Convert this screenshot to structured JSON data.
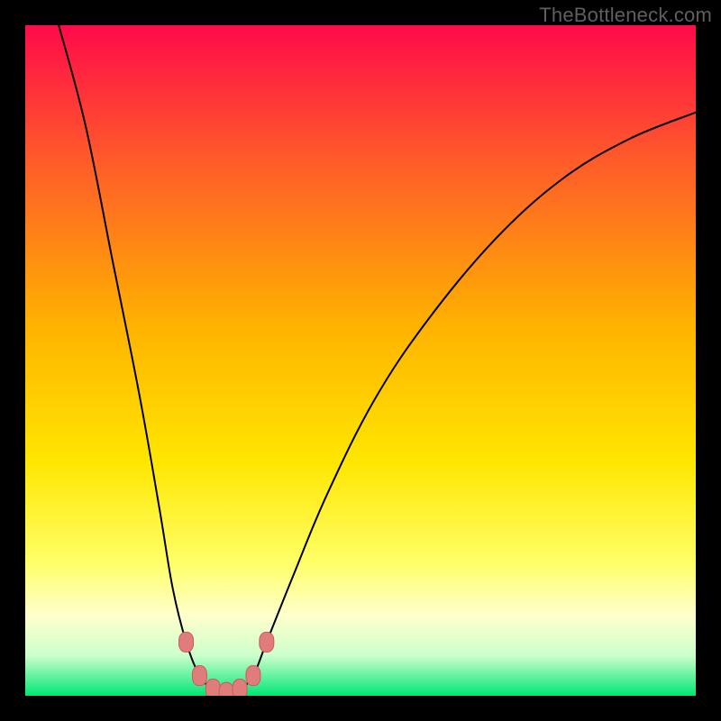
{
  "watermark": "TheBottleneck.com",
  "colors": {
    "frame_bg": "#000000",
    "curve": "#000000",
    "marker_fill": "#e07c7c",
    "marker_stroke": "#cc5b5b",
    "green_band": "#00e676",
    "watermark_text": "#5f5f5f"
  },
  "chart_data": {
    "type": "line",
    "title": "",
    "xlabel": "",
    "ylabel": "",
    "xlim": [
      0,
      100
    ],
    "ylim": [
      0,
      100
    ],
    "gradient_stops": [
      {
        "offset": 0,
        "color": "#ff0a4a"
      },
      {
        "offset": 20,
        "color": "#ff5a2a"
      },
      {
        "offset": 45,
        "color": "#ffb300"
      },
      {
        "offset": 65,
        "color": "#ffe600"
      },
      {
        "offset": 80,
        "color": "#ffff66"
      },
      {
        "offset": 88,
        "color": "#ffffcc"
      },
      {
        "offset": 94,
        "color": "#ccffcc"
      },
      {
        "offset": 100,
        "color": "#00e676"
      }
    ],
    "curve": [
      {
        "x": 5,
        "y": 100
      },
      {
        "x": 9,
        "y": 85
      },
      {
        "x": 13,
        "y": 65
      },
      {
        "x": 17,
        "y": 45
      },
      {
        "x": 20,
        "y": 28
      },
      {
        "x": 22,
        "y": 16
      },
      {
        "x": 24,
        "y": 8
      },
      {
        "x": 26,
        "y": 3
      },
      {
        "x": 28,
        "y": 1
      },
      {
        "x": 30,
        "y": 0.5
      },
      {
        "x": 32,
        "y": 1
      },
      {
        "x": 34,
        "y": 3
      },
      {
        "x": 36,
        "y": 8
      },
      {
        "x": 40,
        "y": 18
      },
      {
        "x": 45,
        "y": 30
      },
      {
        "x": 52,
        "y": 44
      },
      {
        "x": 60,
        "y": 56
      },
      {
        "x": 70,
        "y": 68
      },
      {
        "x": 80,
        "y": 77
      },
      {
        "x": 90,
        "y": 83
      },
      {
        "x": 100,
        "y": 87
      }
    ],
    "markers": [
      {
        "x": 24,
        "y": 8
      },
      {
        "x": 26,
        "y": 3
      },
      {
        "x": 28,
        "y": 1
      },
      {
        "x": 30,
        "y": 0.5
      },
      {
        "x": 32,
        "y": 1
      },
      {
        "x": 34,
        "y": 3
      },
      {
        "x": 36,
        "y": 8
      }
    ]
  }
}
